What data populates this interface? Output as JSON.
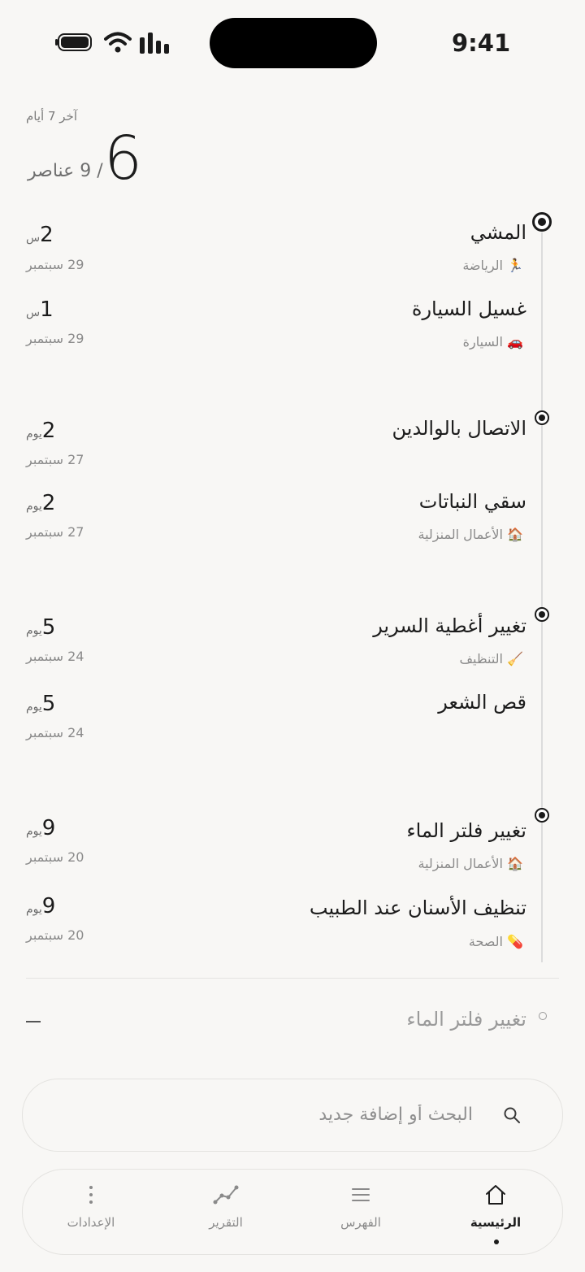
{
  "status_bar": {
    "time": "9:41"
  },
  "header": {
    "range_label": "آخر 7 أيام",
    "done_count": "6",
    "total_label": "/ 9 عناصر"
  },
  "groups": [
    {
      "items": [
        {
          "title": "المشي",
          "category_emoji": "🏃",
          "category": "الرياضة",
          "duration": "2",
          "unit": "س",
          "date": "29 سبتمبر"
        },
        {
          "title": "غسيل السيارة",
          "category_emoji": "🚗",
          "category": "السيارة",
          "duration": "1",
          "unit": "س",
          "date": "29 سبتمبر"
        }
      ]
    },
    {
      "items": [
        {
          "title": "الاتصال بالوالدين",
          "category_emoji": "",
          "category": "",
          "duration": "2",
          "unit": "يوم",
          "date": "27 سبتمبر"
        },
        {
          "title": "سقي النباتات",
          "category_emoji": "🏠",
          "category": "الأعمال المنزلية",
          "duration": "2",
          "unit": "يوم",
          "date": "27 سبتمبر"
        }
      ]
    },
    {
      "items": [
        {
          "title": "تغيير أغطية السرير",
          "category_emoji": "🧹",
          "category": "التنظيف",
          "duration": "5",
          "unit": "يوم",
          "date": "24 سبتمبر"
        },
        {
          "title": "قص الشعر",
          "category_emoji": "",
          "category": "",
          "duration": "5",
          "unit": "يوم",
          "date": "24 سبتمبر"
        }
      ]
    },
    {
      "items": [
        {
          "title": "تغيير فلتر الماء",
          "category_emoji": "🏠",
          "category": "الأعمال المنزلية",
          "duration": "9",
          "unit": "يوم",
          "date": "20 سبتمبر"
        },
        {
          "title": "تنظيف الأسنان عند الطبيب",
          "category_emoji": "💊",
          "category": "الصحة",
          "duration": "9",
          "unit": "يوم",
          "date": "20 سبتمبر"
        }
      ]
    }
  ],
  "next_item": {
    "title": "تغيير فلتر الماء"
  },
  "search": {
    "placeholder": "البحث أو إضافة جديد"
  },
  "tabs": [
    {
      "id": "home",
      "label": "الرئيسية",
      "active": true
    },
    {
      "id": "index",
      "label": "الفهرس",
      "active": false
    },
    {
      "id": "report",
      "label": "التقرير",
      "active": false
    },
    {
      "id": "settings",
      "label": "الإعدادات",
      "active": false
    }
  ]
}
